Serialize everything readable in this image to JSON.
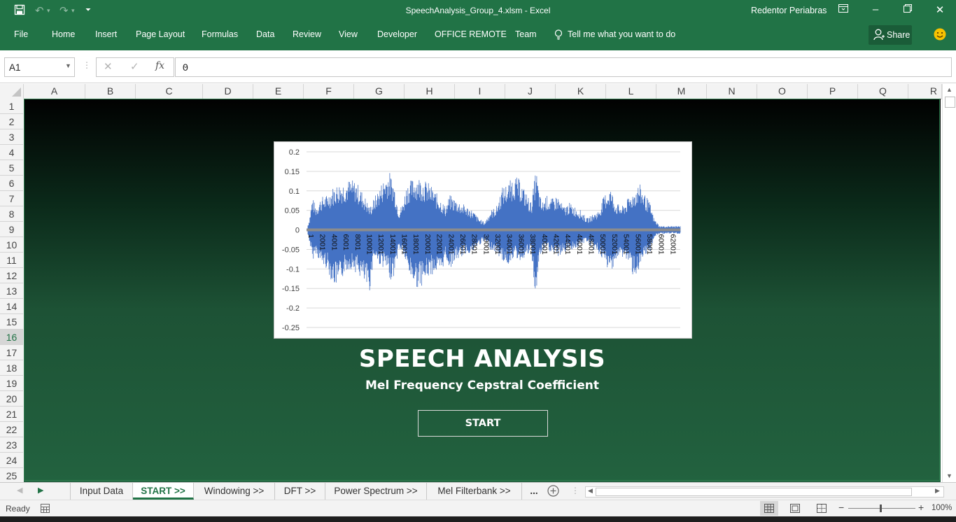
{
  "window": {
    "title": "SpeechAnalysis_Group_4.xlsm  -  Excel",
    "user": "Redentor Periabras"
  },
  "ribbon": {
    "tabs": [
      "File",
      "Home",
      "Insert",
      "Page Layout",
      "Formulas",
      "Data",
      "Review",
      "View",
      "Developer",
      "OFFICE REMOTE",
      "Team"
    ],
    "tell_me": "Tell me what you want to do",
    "share": "Share"
  },
  "formula_bar": {
    "name_box": "A1",
    "fx": "fx",
    "value": "0"
  },
  "columns": [
    "A",
    "B",
    "C",
    "D",
    "E",
    "F",
    "G",
    "H",
    "I",
    "J",
    "K",
    "L",
    "M",
    "N",
    "O",
    "P",
    "Q",
    "R"
  ],
  "rows": [
    "1",
    "2",
    "3",
    "4",
    "5",
    "6",
    "7",
    "8",
    "9",
    "10",
    "11",
    "12",
    "13",
    "14",
    "15",
    "16",
    "17",
    "18",
    "19",
    "20",
    "21",
    "22",
    "23",
    "24",
    "25"
  ],
  "colors": {
    "excel_green": "#217346",
    "waveform": "#4472c4",
    "axis_line": "#8c8c8c"
  },
  "content": {
    "heading": "SPEECH ANALYSIS",
    "subheading": "Mel Frequency Cepstral Coefficient",
    "start_button": "START"
  },
  "chart_data": {
    "type": "line",
    "title": "",
    "xlabel": "",
    "ylabel": "",
    "ylim": [
      -0.25,
      0.2
    ],
    "y_ticks": [
      "0.2",
      "0.15",
      "0.1",
      "0.05",
      "0",
      "-0.05",
      "-0.1",
      "-0.15",
      "-0.2",
      "-0.25"
    ],
    "x_ticks": [
      "1",
      "2001",
      "4001",
      "6001",
      "8001",
      "10001",
      "12001",
      "14001",
      "16001",
      "18001",
      "20001",
      "22001",
      "24001",
      "26001",
      "28001",
      "30001",
      "32001",
      "34001",
      "36001",
      "38001",
      "40001",
      "42001",
      "44001",
      "46001",
      "48001",
      "50001",
      "52001",
      "54001",
      "56001",
      "58001",
      "60001",
      "62001"
    ],
    "x_range": [
      1,
      64000
    ],
    "grid": true,
    "legend": "none",
    "series": [
      {
        "envelope_x": [
          1,
          500,
          1000,
          1600,
          2500,
          3500,
          4500,
          5500,
          6500,
          7500,
          8500,
          9500,
          10200,
          10800,
          11500,
          12500,
          13500,
          14200,
          15000,
          15800,
          16500,
          17200,
          18000,
          19000,
          20000,
          21000,
          22000,
          23000,
          23800,
          24500,
          25500,
          26500,
          27500,
          28500,
          29500,
          30500,
          31500,
          32500,
          33500,
          34500,
          35500,
          36500,
          37500,
          38500,
          39300,
          39800,
          40300,
          41000,
          42000,
          43000,
          44000,
          45000,
          46000,
          47000,
          48000,
          49000,
          50000,
          51000,
          52000,
          53000,
          54000,
          55000,
          56000,
          57000,
          58000,
          58800,
          59500,
          60500,
          61500,
          62500,
          63500,
          64000
        ],
        "upper": [
          0.0,
          0.03,
          0.085,
          0.06,
          0.085,
          0.09,
          0.11,
          0.12,
          0.125,
          0.13,
          0.125,
          0.1,
          0.08,
          0.06,
          0.08,
          0.11,
          0.14,
          0.15,
          0.12,
          0.05,
          0.07,
          0.12,
          0.13,
          0.14,
          0.13,
          0.12,
          0.1,
          0.08,
          0.06,
          0.09,
          0.08,
          0.07,
          0.06,
          0.05,
          0.03,
          0.02,
          0.05,
          0.06,
          0.11,
          0.12,
          0.14,
          0.13,
          0.1,
          0.07,
          0.16,
          0.1,
          0.07,
          0.09,
          0.08,
          0.09,
          0.06,
          0.07,
          0.06,
          0.05,
          0.03,
          0.04,
          0.05,
          0.09,
          0.11,
          0.07,
          0.06,
          0.08,
          0.1,
          0.12,
          0.09,
          0.07,
          0.03,
          0.01,
          0.01,
          0.01,
          0.01,
          0.01
        ],
        "lower": [
          0.0,
          -0.03,
          -0.08,
          -0.06,
          -0.09,
          -0.1,
          -0.14,
          -0.15,
          -0.11,
          -0.1,
          -0.11,
          -0.13,
          -0.15,
          -0.16,
          -0.07,
          -0.09,
          -0.1,
          -0.13,
          -0.12,
          -0.05,
          -0.06,
          -0.1,
          -0.13,
          -0.15,
          -0.14,
          -0.12,
          -0.11,
          -0.12,
          -0.07,
          -0.1,
          -0.08,
          -0.07,
          -0.06,
          -0.06,
          -0.04,
          -0.03,
          -0.05,
          -0.06,
          -0.08,
          -0.09,
          -0.07,
          -0.08,
          -0.07,
          -0.06,
          -0.19,
          -0.08,
          -0.06,
          -0.05,
          -0.06,
          -0.07,
          -0.06,
          -0.05,
          -0.05,
          -0.04,
          -0.03,
          -0.05,
          -0.06,
          -0.09,
          -0.11,
          -0.08,
          -0.07,
          -0.08,
          -0.12,
          -0.11,
          -0.07,
          -0.06,
          -0.02,
          -0.01,
          -0.01,
          -0.01,
          -0.01,
          -0.01
        ]
      }
    ]
  },
  "sheet_tabs": [
    "Input Data",
    "START >>",
    "Windowing >>",
    "DFT >>",
    "Power Spectrum >>",
    "Mel Filterbank >>",
    "..."
  ],
  "active_sheet": "START >>",
  "status": {
    "ready": "Ready",
    "zoom": "100%"
  }
}
